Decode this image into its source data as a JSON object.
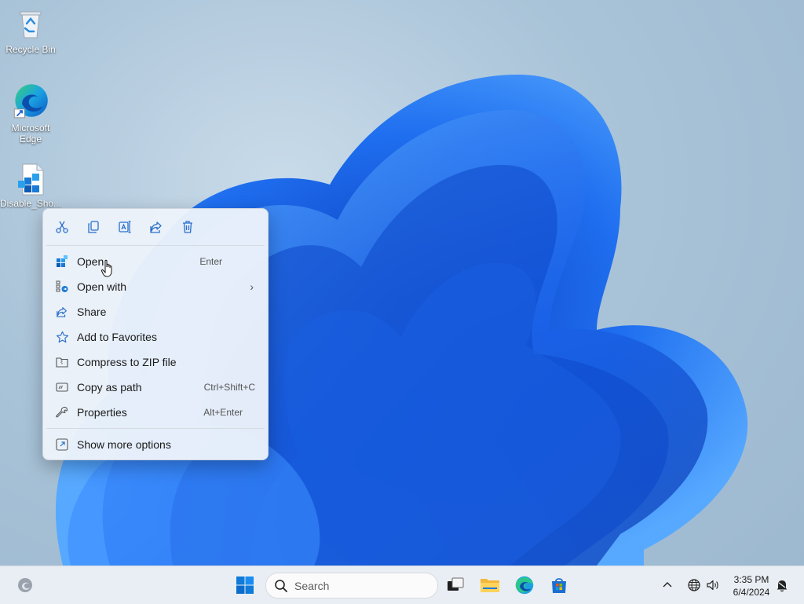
{
  "desktop": {
    "icons": [
      {
        "label": "Recycle Bin",
        "icon": "recycle-bin-icon"
      },
      {
        "label": "Microsoft Edge",
        "icon": "edge-icon"
      },
      {
        "label": "Disable_Sho...",
        "icon": "registry-file-icon"
      }
    ]
  },
  "context_menu": {
    "toolbar": [
      {
        "name": "cut",
        "icon": "scissors-icon"
      },
      {
        "name": "copy",
        "icon": "copy-icon"
      },
      {
        "name": "rename",
        "icon": "rename-icon"
      },
      {
        "name": "share",
        "icon": "share-icon"
      },
      {
        "name": "delete",
        "icon": "trash-icon"
      }
    ],
    "items": [
      {
        "label": "Open",
        "shortcut": "Enter",
        "icon": "open-icon"
      },
      {
        "label": "Open with",
        "shortcut": "",
        "icon": "open-with-icon",
        "submenu": true
      },
      {
        "label": "Share",
        "shortcut": "",
        "icon": "share-icon"
      },
      {
        "label": "Add to Favorites",
        "shortcut": "",
        "icon": "star-icon"
      },
      {
        "label": "Compress to ZIP file",
        "shortcut": "",
        "icon": "zip-icon"
      },
      {
        "label": "Copy as path",
        "shortcut": "Ctrl+Shift+C",
        "icon": "copy-path-icon"
      },
      {
        "label": "Properties",
        "shortcut": "Alt+Enter",
        "icon": "wrench-icon"
      }
    ],
    "more": {
      "label": "Show more options",
      "icon": "more-options-icon"
    }
  },
  "taskbar": {
    "search_placeholder": "Search",
    "clock_time": "3:35 PM",
    "clock_date": "6/4/2024",
    "colors": {
      "accent": "#0067c0",
      "background": "#e9eef4"
    }
  }
}
